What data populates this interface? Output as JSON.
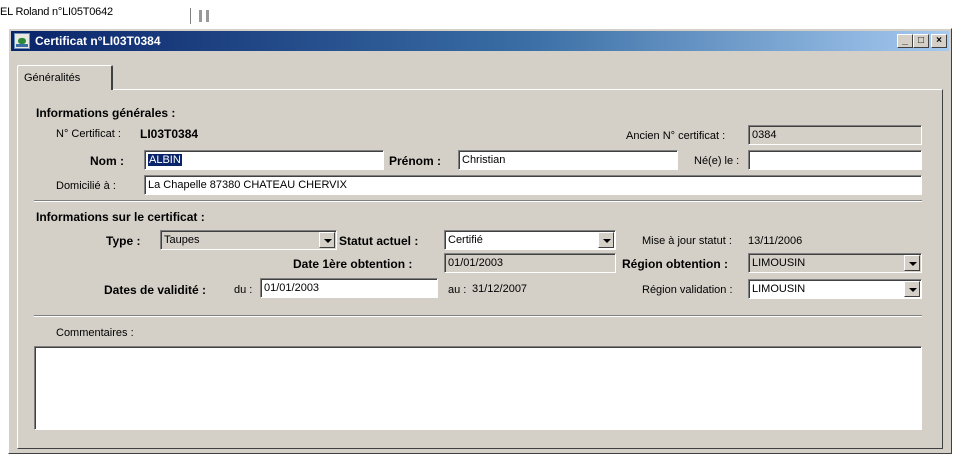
{
  "background_window": {
    "title": "EL Roland n°LI05T0642"
  },
  "window": {
    "title": "Certificat n°LI03T0384",
    "controls": {
      "minimize": "_",
      "maximize": "□",
      "close": "×"
    }
  },
  "tab": {
    "label": "Généralités"
  },
  "general": {
    "heading": "Informations générales :",
    "cert_number_label": "N° Certificat :",
    "cert_number_value": "LI03T0384",
    "old_cert_label": "Ancien N° certificat :",
    "old_cert_value": "0384",
    "nom_label": "Nom :",
    "nom_value": "ALBIN",
    "prenom_label": "Prénom :",
    "prenom_value": "Christian",
    "birth_label": "Né(e) le :",
    "birth_value": "",
    "domicile_label": "Domicilié à :",
    "domicile_value": "La Chapelle 87380 CHATEAU CHERVIX"
  },
  "certificate": {
    "heading": "Informations sur le certificat :",
    "type_label": "Type :",
    "type_value": "Taupes",
    "statut_label": "Statut actuel :",
    "statut_value": "Certifié",
    "maj_label": "Mise à jour statut :",
    "maj_value": "13/11/2006",
    "date_obtention_label": "Date 1ère obtention :",
    "date_obtention_value": "01/01/2003",
    "region_obtention_label": "Région obtention :",
    "region_obtention_value": "LIMOUSIN",
    "validite_label": "Dates de validité :",
    "du_label": "du :",
    "du_value": "01/01/2003",
    "au_label": "au :",
    "au_value": "31/12/2007",
    "region_validation_label": "Région validation :",
    "region_validation_value": "LIMOUSIN"
  },
  "comments": {
    "label": "Commentaires :",
    "value": ""
  }
}
